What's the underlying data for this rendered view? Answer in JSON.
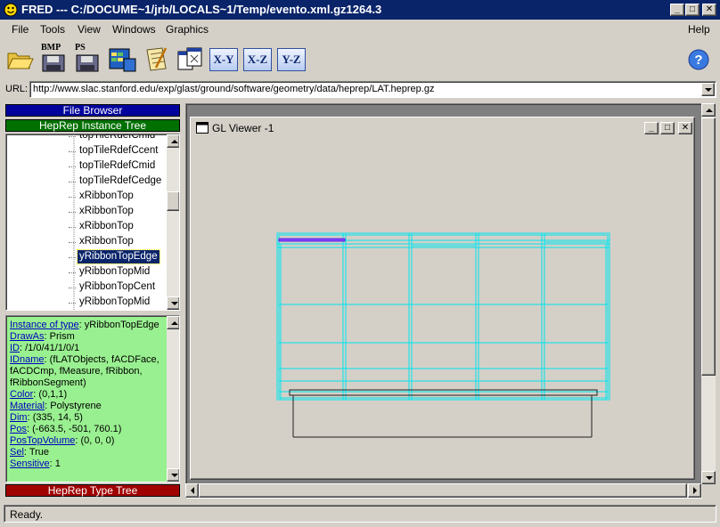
{
  "window": {
    "title": "FRED --- C:/DOCUME~1/jrb/LOCALS~1/Temp/evento.xml.gz1264.3",
    "controls": [
      "minimize",
      "maximize",
      "close"
    ]
  },
  "menu": {
    "file": "File",
    "tools": "Tools",
    "windows": "Windows",
    "graphics": "Graphics",
    "help": "Help"
  },
  "toolbar": {
    "open": "open-folder-icon",
    "bmp_label": "BMP",
    "ps_label": "PS",
    "xy": "X-Y",
    "xz": "X-Z",
    "yz": "Y-Z",
    "help": "?"
  },
  "url": {
    "label": "URL:",
    "value": "http://www.slac.stanford.edu/exp/glast/ground/software/geometry/data/heprep/LAT.heprep.gz"
  },
  "left_panel": {
    "file_browser": "File Browser",
    "instance_tree": "HepRep Instance Tree",
    "type_tree": "HepRep Type Tree",
    "file_browser_color": "#00009c",
    "instance_tree_color": "#007000",
    "type_tree_color": "#a00000"
  },
  "tree": {
    "items": [
      "topTileRdefCmid",
      "topTileRdefCcent",
      "topTileRdefCmid",
      "topTileRdefCedge",
      "xRibbonTop",
      "xRibbonTop",
      "xRibbonTop",
      "xRibbonTop",
      "yRibbonTopEdge",
      "yRibbonTopMid",
      "yRibbonTopCent",
      "yRibbonTopMid"
    ],
    "selected_index": 8
  },
  "properties": {
    "instance_of_type": {
      "key": "Instance of type",
      "value": "yRibbonTopEdge"
    },
    "draw_as": {
      "key": "DrawAs",
      "value": "Prism"
    },
    "id": {
      "key": "ID",
      "value": "/1/0/41/1/0/1"
    },
    "idname": {
      "key": "IDname",
      "value": "(fLATObjects, fACDFace, fACDCmp, fMeasure, fRibbon, fRibbonSegment)"
    },
    "color": {
      "key": "Color",
      "value": "(0,1,1)"
    },
    "material": {
      "key": "Material",
      "value": "Polystyrene"
    },
    "dim": {
      "key": "Dim",
      "value": "(335, 14, 5)"
    },
    "pos": {
      "key": "Pos",
      "value": "(-663.5, -501, 760.1)"
    },
    "pos_top_volume": {
      "key": "PosTopVolume",
      "value": "(0, 0, 0)"
    },
    "sel": {
      "key": "Sel",
      "value": "True"
    },
    "sensitive": {
      "key": "Sensitive",
      "value": "1"
    }
  },
  "viewer": {
    "title": "GL Viewer -1",
    "geometry_color": "#00e5ee",
    "highlight_color": "#8040ff"
  },
  "status": {
    "text": "Ready."
  }
}
